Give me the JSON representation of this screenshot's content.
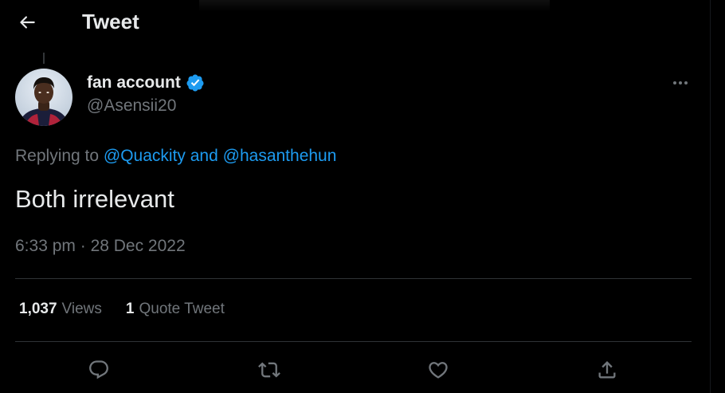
{
  "header": {
    "title": "Tweet"
  },
  "author": {
    "display_name": "fan account",
    "handle": "@Asensii20",
    "verified": true,
    "verified_color": "#1d9bf0"
  },
  "replying": {
    "prefix": "Replying to ",
    "mention_1": "@Quackity",
    "joiner": " and ",
    "mention_2": "@hasanthehun"
  },
  "tweet": {
    "text": "Both irrelevant",
    "time": "6:33 pm",
    "separator": " · ",
    "date": "28 Dec 2022"
  },
  "stats": {
    "views_count": "1,037",
    "views_label": "Views",
    "quotes_count": "1",
    "quotes_label": "Quote Tweet"
  },
  "actions": {
    "icons": [
      "reply-icon",
      "retweet-icon",
      "like-icon",
      "share-icon"
    ]
  },
  "colors": {
    "background": "#000000",
    "text_primary": "#e7e9ea",
    "text_secondary": "#71767b",
    "accent": "#1d9bf0",
    "divider": "#2f3336"
  }
}
